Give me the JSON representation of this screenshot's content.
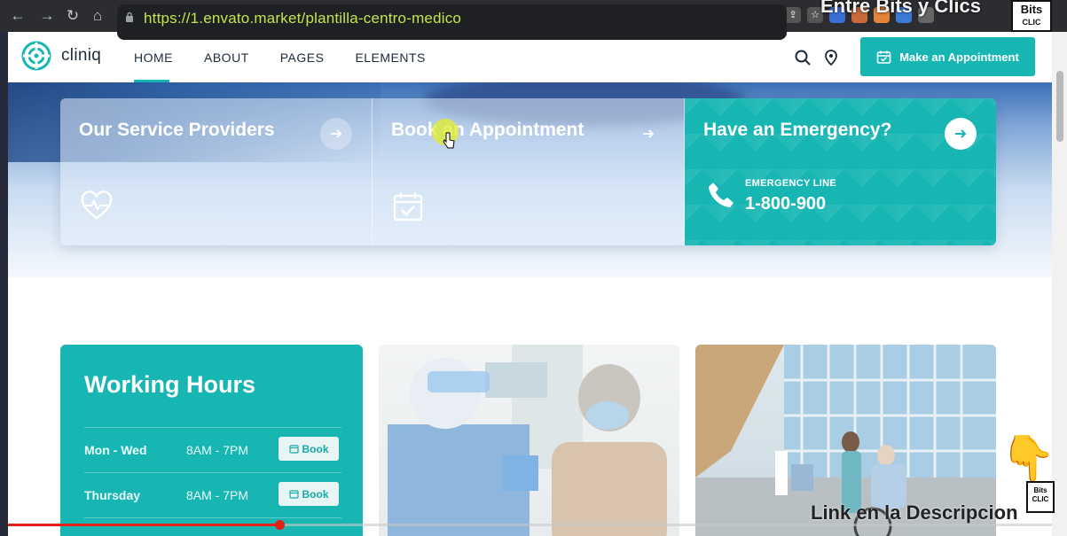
{
  "browser": {
    "url": "https://1.envato.market/plantilla-centro-medico",
    "channel_title": "Entre Bits y Clics",
    "channel_logo_line1": "Bits",
    "channel_logo_line2": "CLIC"
  },
  "site": {
    "brand": "cliniq",
    "nav": [
      "HOME",
      "ABOUT",
      "PAGES",
      "ELEMENTS"
    ],
    "active_nav": "HOME",
    "appointment_button": "Make an Appointment",
    "accent_color": "#18b6b3"
  },
  "cards": [
    {
      "title": "Our Service Providers",
      "icon": "heart-pulse-icon"
    },
    {
      "title": "Book an Appointment",
      "icon": "calendar-check-icon"
    },
    {
      "title": "Have an Emergency?",
      "emergency_label": "EMERGENCY LINE",
      "phone": "1-800-900",
      "icon": "phone-icon"
    }
  ],
  "working_hours": {
    "title": "Working Hours",
    "rows": [
      {
        "day": "Mon - Wed",
        "time": "8AM - 7PM",
        "button": "Book"
      },
      {
        "day": "Thursday",
        "time": "8AM - 7PM",
        "button": "Book"
      }
    ]
  },
  "video": {
    "caption": "Link en la Descripcion",
    "progress_fraction": 0.26
  }
}
